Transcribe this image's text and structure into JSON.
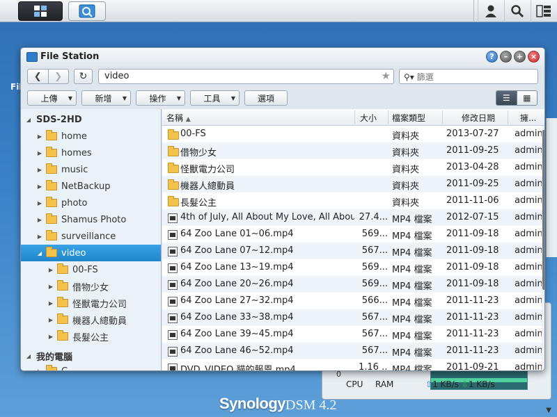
{
  "window": {
    "title": "File Station"
  },
  "nav": {
    "path": "video",
    "search_placeholder": "篩選"
  },
  "toolbar": {
    "upload": "上傳",
    "create": "新增",
    "action": "操作",
    "tools": "工具",
    "settings": "選項"
  },
  "tree": {
    "root": "SDS-2HD",
    "items": [
      "home",
      "homes",
      "music",
      "NetBackup",
      "photo",
      "Shamus Photo",
      "surveillance",
      "video"
    ],
    "video_children": [
      "00-FS",
      "借物少女",
      "怪獸電力公司",
      "機器人總動員",
      "長髮公主"
    ],
    "my_computer": "我的電腦",
    "my_computer_partial": "C"
  },
  "list": {
    "headers": {
      "name": "名稱",
      "size": "大小",
      "type": "檔案類型",
      "modified": "修改日期",
      "owner": "擁..."
    },
    "rows": [
      {
        "name": "00-FS",
        "size": "",
        "type": "資料夾",
        "date": "2013-07-27",
        "owner": "admin",
        "kind": "folder"
      },
      {
        "name": "借物少女",
        "size": "",
        "type": "資料夾",
        "date": "2011-09-25",
        "owner": "admin",
        "kind": "folder"
      },
      {
        "name": "怪獸電力公司",
        "size": "",
        "type": "資料夾",
        "date": "2013-04-28",
        "owner": "admin",
        "kind": "folder"
      },
      {
        "name": "機器人總動員",
        "size": "",
        "type": "資料夾",
        "date": "2011-09-25",
        "owner": "admin",
        "kind": "folder"
      },
      {
        "name": "長髮公主",
        "size": "",
        "type": "資料夾",
        "date": "2011-11-06",
        "owner": "admin",
        "kind": "folder"
      },
      {
        "name": "4th of July, All About My Love, All About",
        "size": "27.4...",
        "type": "MP4 檔案",
        "date": "2012-07-15",
        "owner": "admin",
        "kind": "video"
      },
      {
        "name": "64 Zoo Lane 01~06.mp4",
        "size": "569...",
        "type": "MP4 檔案",
        "date": "2011-09-18",
        "owner": "admin",
        "kind": "video"
      },
      {
        "name": "64 Zoo Lane 07~12.mp4",
        "size": "567...",
        "type": "MP4 檔案",
        "date": "2011-09-18",
        "owner": "admin",
        "kind": "video"
      },
      {
        "name": "64 Zoo Lane 13~19.mp4",
        "size": "569...",
        "type": "MP4 檔案",
        "date": "2011-09-18",
        "owner": "admin",
        "kind": "video"
      },
      {
        "name": "64 Zoo Lane 20~26.mp4",
        "size": "569...",
        "type": "MP4 檔案",
        "date": "2011-09-18",
        "owner": "admin",
        "kind": "video"
      },
      {
        "name": "64 Zoo Lane 27~32.mp4",
        "size": "566...",
        "type": "MP4 檔案",
        "date": "2011-11-23",
        "owner": "admin",
        "kind": "video"
      },
      {
        "name": "64 Zoo Lane 33~38.mp4",
        "size": "567...",
        "type": "MP4 檔案",
        "date": "2011-11-23",
        "owner": "admin",
        "kind": "video"
      },
      {
        "name": "64 Zoo Lane 39~45.mp4",
        "size": "567...",
        "type": "MP4 檔案",
        "date": "2011-11-23",
        "owner": "admin",
        "kind": "video"
      },
      {
        "name": "64 Zoo Lane 46~52.mp4",
        "size": "567...",
        "type": "MP4 檔案",
        "date": "2011-11-23",
        "owner": "admin",
        "kind": "video"
      },
      {
        "name": "DVD_VIDEO 貓的報恩.mp4",
        "size": "1.16 ...",
        "type": "MP4 檔案",
        "date": "2011-09-21",
        "owner": "admin",
        "kind": "video"
      }
    ]
  },
  "desktop": {
    "left_label": "Fil",
    "widget": {
      "cpu": "CPU",
      "ram": "RAM",
      "upload": "1 KB/s",
      "download": "1 KB/s",
      "zero": "0"
    },
    "brand": "Synology",
    "dsm": "DSM 4.2"
  }
}
